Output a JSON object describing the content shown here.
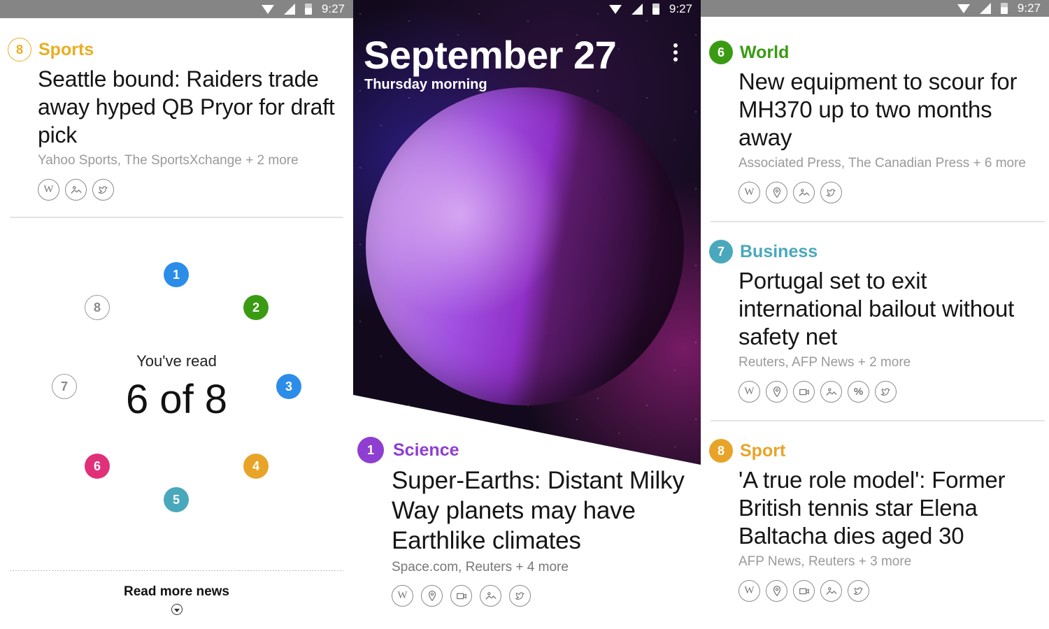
{
  "status_bar": {
    "time": "9:27",
    "icons": [
      "wifi-icon",
      "signal-icon",
      "battery-icon"
    ]
  },
  "colors": {
    "sports": "#e8ae24",
    "science": "#8e3ed0",
    "world": "#3a9b13",
    "business": "#4aa8bc",
    "sport": "#e8a428",
    "blue": "#2b8de8",
    "pink": "#e0307a",
    "unread": "#9a9a9a"
  },
  "left": {
    "article": {
      "number": "8",
      "category": "Sports",
      "headline": "Seattle bound: Raiders trade away hyped QB Pryor for draft pick",
      "sources": "Yahoo Sports, The SportsXchange + 2 more",
      "icons": [
        "wikipedia-icon",
        "image-icon",
        "twitter-icon"
      ]
    },
    "progress": {
      "label": "You've read",
      "count_text": "6 of 8",
      "read": 6,
      "total": 8,
      "rings": [
        {
          "n": "1",
          "read": true,
          "color": "#2b8de8"
        },
        {
          "n": "2",
          "read": true,
          "color": "#3a9b13"
        },
        {
          "n": "3",
          "read": true,
          "color": "#2b8de8"
        },
        {
          "n": "4",
          "read": true,
          "color": "#e8a428"
        },
        {
          "n": "5",
          "read": true,
          "color": "#4aa8bc"
        },
        {
          "n": "6",
          "read": true,
          "color": "#e0307a"
        },
        {
          "n": "7",
          "read": false,
          "color": "#9a9a9a"
        },
        {
          "n": "8",
          "read": false,
          "color": "#9a9a9a"
        }
      ]
    },
    "read_more_label": "Read more news"
  },
  "middle": {
    "date": "September 27",
    "daypart": "Thursday morning",
    "article": {
      "number": "1",
      "category": "Science",
      "headline": "Super-Earths: Distant Milky Way planets may have Earthlike climates",
      "sources": "Space.com, Reuters + 4 more",
      "icons": [
        "wikipedia-icon",
        "location-icon",
        "video-icon",
        "image-icon",
        "twitter-icon"
      ]
    }
  },
  "right": {
    "articles": [
      {
        "number": "6",
        "category": "World",
        "headline": "New equipment to scour for MH370 up to two months away",
        "sources": "Associated Press, The Canadian Press + 6 more",
        "icons": [
          "wikipedia-icon",
          "location-icon",
          "image-icon",
          "twitter-icon"
        ]
      },
      {
        "number": "7",
        "category": "Business",
        "headline": "Portugal set to exit international bailout without safety net",
        "sources": "Reuters, AFP News + 2 more",
        "icons": [
          "wikipedia-icon",
          "location-icon",
          "video-icon",
          "image-icon",
          "percent-icon",
          "twitter-icon"
        ]
      },
      {
        "number": "8",
        "category": "Sport",
        "headline": "'A true role model': Former British tennis star Elena Baltacha dies aged 30",
        "sources": "AFP News, Reuters + 3 more",
        "icons": [
          "wikipedia-icon",
          "location-icon",
          "video-icon",
          "image-icon",
          "twitter-icon"
        ]
      }
    ]
  }
}
